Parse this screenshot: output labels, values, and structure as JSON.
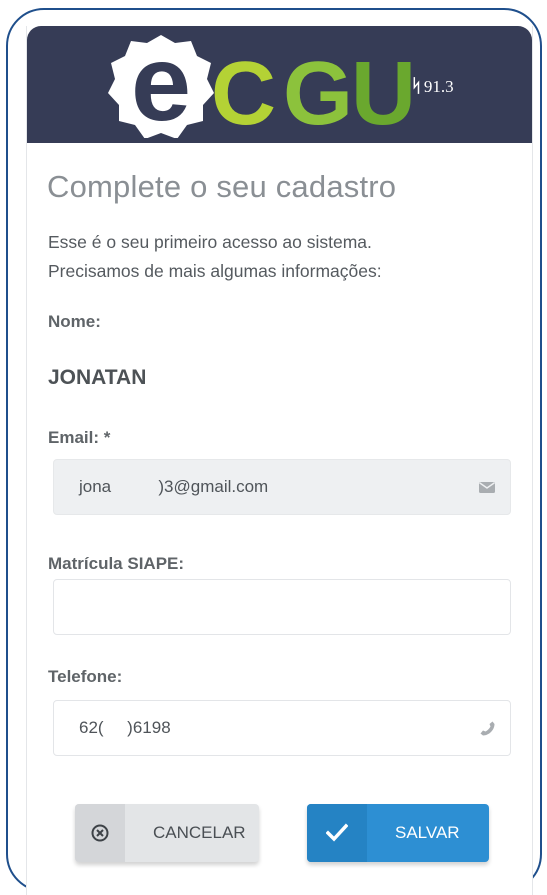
{
  "header": {
    "logo_text": "eCGU",
    "version": "91.3",
    "colors": {
      "background": "#363c56",
      "logo_green_light": "#b4d235",
      "logo_green_dark": "#6aa82e"
    }
  },
  "form": {
    "title": "Complete o seu cadastro",
    "intro_line1": "Esse é o seu primeiro acesso ao sistema.",
    "intro_line2": "Precisamos de mais algumas informações:",
    "name_label": "Nome:",
    "name_value": "JONATAN",
    "email_label": "Email: *",
    "email_value": "jona          )3@gmail.com",
    "email_icon": "envelope-icon",
    "siape_label": "Matrícula SIAPE:",
    "siape_value": "",
    "phone_label": "Telefone:",
    "phone_value": "62(     )6198",
    "phone_icon": "phone-icon"
  },
  "actions": {
    "cancel_label": "CANCELAR",
    "cancel_icon": "circle-x-icon",
    "save_label": "SALVAR",
    "save_icon": "checkmark-icon",
    "save_color": "#2d8fd3"
  }
}
